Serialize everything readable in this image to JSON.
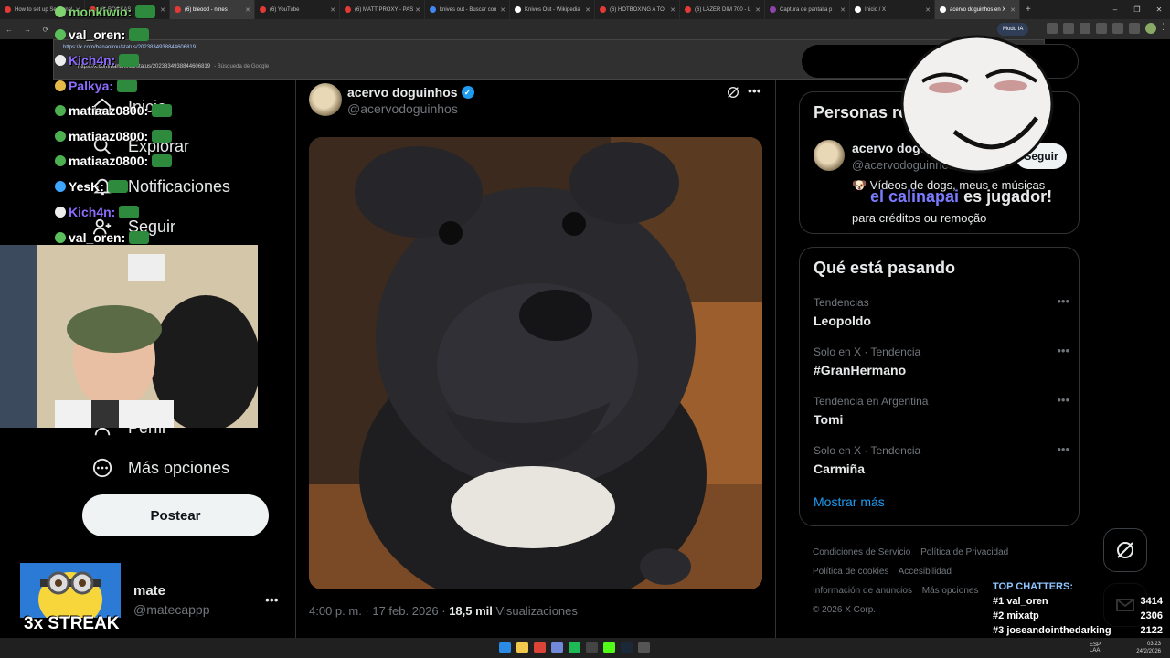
{
  "browser": {
    "tabs": [
      {
        "label": "How to set up Seasonal",
        "color": "#e53935"
      },
      {
        "label": "(6) BOOKAS",
        "color": "#e53935"
      },
      {
        "label": "(6) bleood - nines",
        "color": "#e53935",
        "active": true
      },
      {
        "label": "(6) YouTube",
        "color": "#e53935"
      },
      {
        "label": "(6) MATT PROXY - PAS",
        "color": "#e53935"
      },
      {
        "label": "knives out - Buscar con",
        "color": "#4285f4"
      },
      {
        "label": "Knives Out - Wikipedia",
        "color": "#ffffff"
      },
      {
        "label": "(6) HOTBOXING A TO",
        "color": "#e53935"
      },
      {
        "label": "(6) LAZER DIM 700 - L",
        "color": "#e53935"
      },
      {
        "label": "Captura de pantalla p",
        "color": "#8e44ad"
      },
      {
        "label": "Inicio / X",
        "color": "#ffffff"
      },
      {
        "label": "acervo doguinhos en X",
        "color": "#ffffff",
        "active": true
      }
    ],
    "url": "x.com/bananirou/status/2023834938844606819",
    "omnibox_suggestion_url": "https://x.com/bananirou/status/2023834938844606819",
    "omnibox_suggestion_2": "https://x.com/bananirou/status/2023834938844606819",
    "omnibox_suggestion_2_sub": "- Búsqueda de Google",
    "modo_ia": "Modo IA"
  },
  "nav": {
    "items": [
      {
        "label": "Inicio",
        "icon": "home-icon"
      },
      {
        "label": "Explorar",
        "icon": "search-icon"
      },
      {
        "label": "Notificaciones",
        "icon": "bell-icon"
      },
      {
        "label": "Seguir",
        "icon": "follow-icon"
      },
      {
        "label": "Perfil",
        "icon": "person-icon"
      },
      {
        "label": "Más opciones",
        "icon": "more-circle-icon"
      }
    ],
    "post_button": "Postear",
    "account_name": "mate",
    "account_handle": "@matecappp"
  },
  "tweet": {
    "author_name": "acervo doguinhos",
    "author_handle": "@acervodoguinhos",
    "time": "4:00 p. m. · 17 feb. 2026 · ",
    "views_count": "18,5 mil",
    "views_label": " Visualizaciones"
  },
  "sidebar": {
    "people_title": "Personas re",
    "person_name": "acervo dogui",
    "person_handle": "@acervodoguinhos",
    "follow_label": "Seguir",
    "bio_line1": "🐶 Vídeos de dogs, meus e músicas",
    "bio_line2": "para créditos ou remoção",
    "trends_title": "Qué está pasando",
    "trends": [
      {
        "context": "Tendencias",
        "title": "Leopoldo"
      },
      {
        "context": "Solo en X · Tendencia",
        "title": "#GranHermano"
      },
      {
        "context": "Tendencia en Argentina",
        "title": "Tomi"
      },
      {
        "context": "Solo en X · Tendencia",
        "title": "Carmiña"
      }
    ],
    "show_more": "Mostrar más",
    "footer": [
      "Condiciones de Servicio",
      "Política de Privacidad",
      "Política de cookies",
      "Accesibilidad",
      "Información de anuncios",
      "Más opciones",
      "© 2026 X Corp."
    ]
  },
  "overlay": {
    "chat": [
      {
        "user": "monkiwio:",
        "color": "#7fd36f"
      },
      {
        "user": "val_oren:",
        "color": "#ffffff"
      },
      {
        "user": "Kich4n:",
        "color": "#8d6bff"
      },
      {
        "user": "Palkya:",
        "color": "#8d6bff"
      },
      {
        "user": "matiaaz0800:",
        "color": "#ffffff"
      },
      {
        "user": "matiaaz0800:",
        "color": "#ffffff"
      },
      {
        "user": "matiaaz0800:",
        "color": "#ffffff"
      },
      {
        "user": "YesK:",
        "color": "#ffffff"
      },
      {
        "user": "Kich4n:",
        "color": "#8d6bff"
      },
      {
        "user": "val_oren:",
        "color": "#ffffff"
      }
    ],
    "alert_user": "el calinapai",
    "alert_text": " es jugador!",
    "streak": "3x STREAK",
    "top_chatters_title": "TOP CHATTERS:",
    "top_chatters": [
      {
        "rank": "#1",
        "name": "val_oren",
        "count": "3414"
      },
      {
        "rank": "#2",
        "name": "mixatp",
        "count": "2306"
      },
      {
        "rank": "#3",
        "name": "joseandointhedarking",
        "count": "2122"
      }
    ]
  },
  "taskbar": {
    "lang": "ESP\nLAA",
    "time": "03:23",
    "date": "24/2/2026"
  }
}
